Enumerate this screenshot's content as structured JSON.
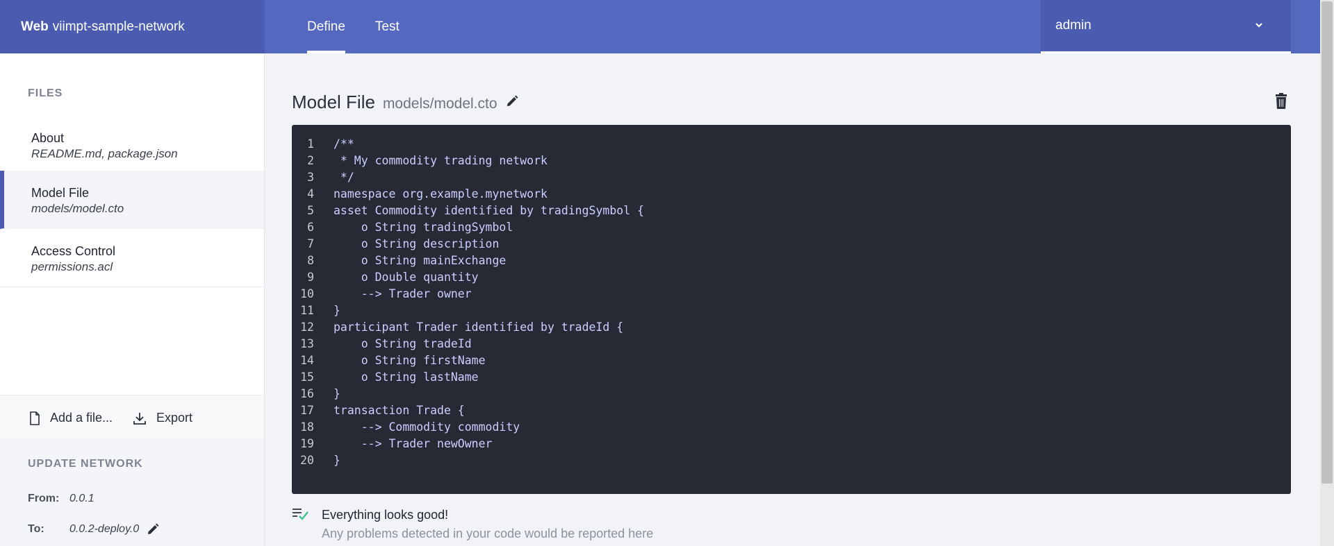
{
  "app": {
    "brand_bold": "Web",
    "brand_name": "viimpt-sample-network"
  },
  "tabs": [
    {
      "label": "Define",
      "active": true
    },
    {
      "label": "Test",
      "active": false
    }
  ],
  "user": {
    "name": "admin"
  },
  "sidebar": {
    "files_heading": "FILES",
    "files": [
      {
        "name": "About",
        "sub": "README.md, package.json",
        "active": false
      },
      {
        "name": "Model File",
        "sub": "models/model.cto",
        "active": true
      },
      {
        "name": "Access Control",
        "sub": "permissions.acl",
        "active": false
      }
    ],
    "add_file_label": "Add a file...",
    "export_label": "Export",
    "update_heading": "UPDATE NETWORK",
    "from_label": "From:",
    "from_value": "0.0.1",
    "to_label": "To:",
    "to_value": "0.0.2-deploy.0"
  },
  "main": {
    "title": "Model File",
    "path": "models/model.cto"
  },
  "editor": {
    "lines": [
      "/**",
      " * My commodity trading network",
      " */",
      "namespace org.example.mynetwork",
      "asset Commodity identified by tradingSymbol {",
      "    o String tradingSymbol",
      "    o String description",
      "    o String mainExchange",
      "    o Double quantity",
      "    --> Trader owner",
      "}",
      "participant Trader identified by tradeId {",
      "    o String tradeId",
      "    o String firstName",
      "    o String lastName",
      "}",
      "transaction Trade {",
      "    --> Commodity commodity",
      "    --> Trader newOwner",
      "}"
    ]
  },
  "status": {
    "title": "Everything looks good!",
    "subtitle": "Any problems detected in your code would be reported here"
  },
  "colors": {
    "accent": "#4a5bb0",
    "topbar": "#5568c0",
    "editor_bg": "#272a35",
    "ok": "#3fbf8f"
  }
}
